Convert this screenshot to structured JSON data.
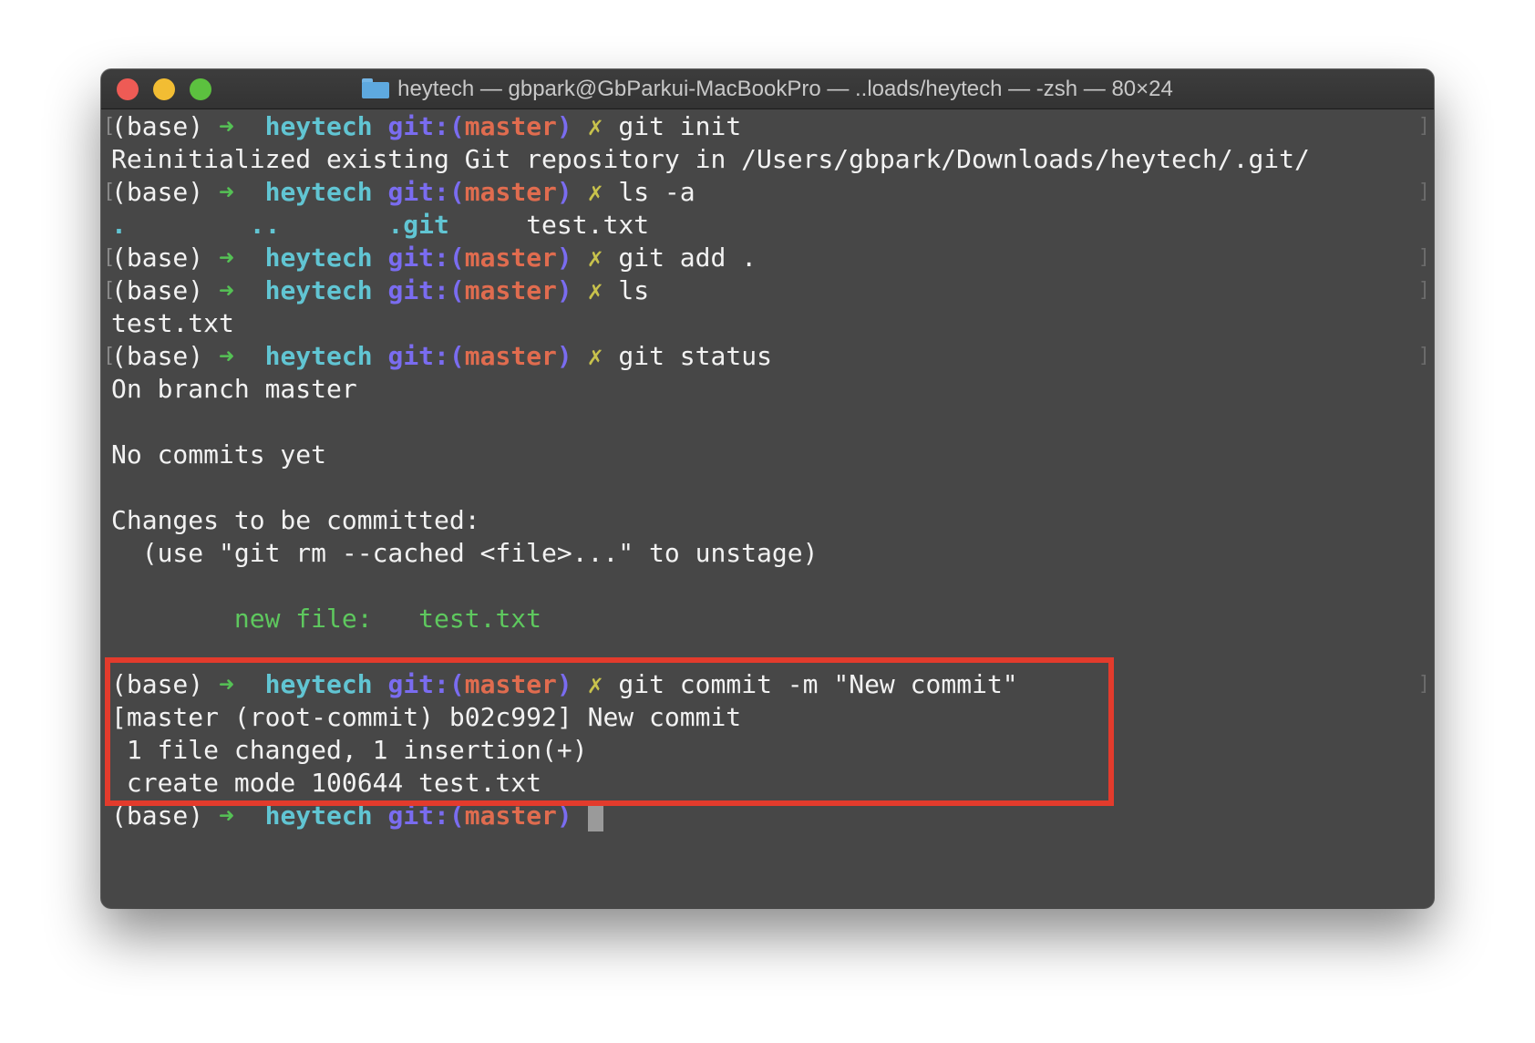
{
  "window": {
    "title": "heytech — gbpark@GbParkui-MacBookPro — ..loads/heytech — -zsh — 80×24"
  },
  "prompt": {
    "env": "(base)",
    "arrow": "➜",
    "dir": "heytech",
    "git_prefix": "git:(",
    "branch": "master",
    "git_suffix": ")",
    "dirty": "✗"
  },
  "lines": [
    {
      "type": "prompt",
      "command": "git init"
    },
    {
      "type": "output",
      "text": "Reinitialized existing Git repository in /Users/gbpark/Downloads/heytech/.git/"
    },
    {
      "type": "prompt",
      "command": "ls -a"
    },
    {
      "type": "dirlist",
      "items": [
        ".",
        "..",
        ".git"
      ],
      "file": "test.txt"
    },
    {
      "type": "prompt",
      "command": "git add ."
    },
    {
      "type": "prompt",
      "command": "ls"
    },
    {
      "type": "output",
      "text": "test.txt"
    },
    {
      "type": "prompt",
      "command": "git status"
    },
    {
      "type": "output",
      "text": "On branch master"
    },
    {
      "type": "blank"
    },
    {
      "type": "output",
      "text": "No commits yet"
    },
    {
      "type": "blank"
    },
    {
      "type": "output",
      "text": "Changes to be committed:"
    },
    {
      "type": "output",
      "text": "  (use \"git rm --cached <file>...\" to unstage)"
    },
    {
      "type": "blank"
    },
    {
      "type": "green",
      "label": "new file:",
      "file": "test.txt"
    },
    {
      "type": "blank"
    },
    {
      "type": "prompt",
      "command": "git commit -m \"New commit\""
    },
    {
      "type": "output",
      "text": "[master (root-commit) b02c992] New commit"
    },
    {
      "type": "output",
      "text": " 1 file changed, 1 insertion(+)"
    },
    {
      "type": "output",
      "text": " create mode 100644 test.txt"
    },
    {
      "type": "prompt_current"
    }
  ],
  "colors": {
    "highlight_box": "#e33b2c",
    "background": "#474747"
  }
}
